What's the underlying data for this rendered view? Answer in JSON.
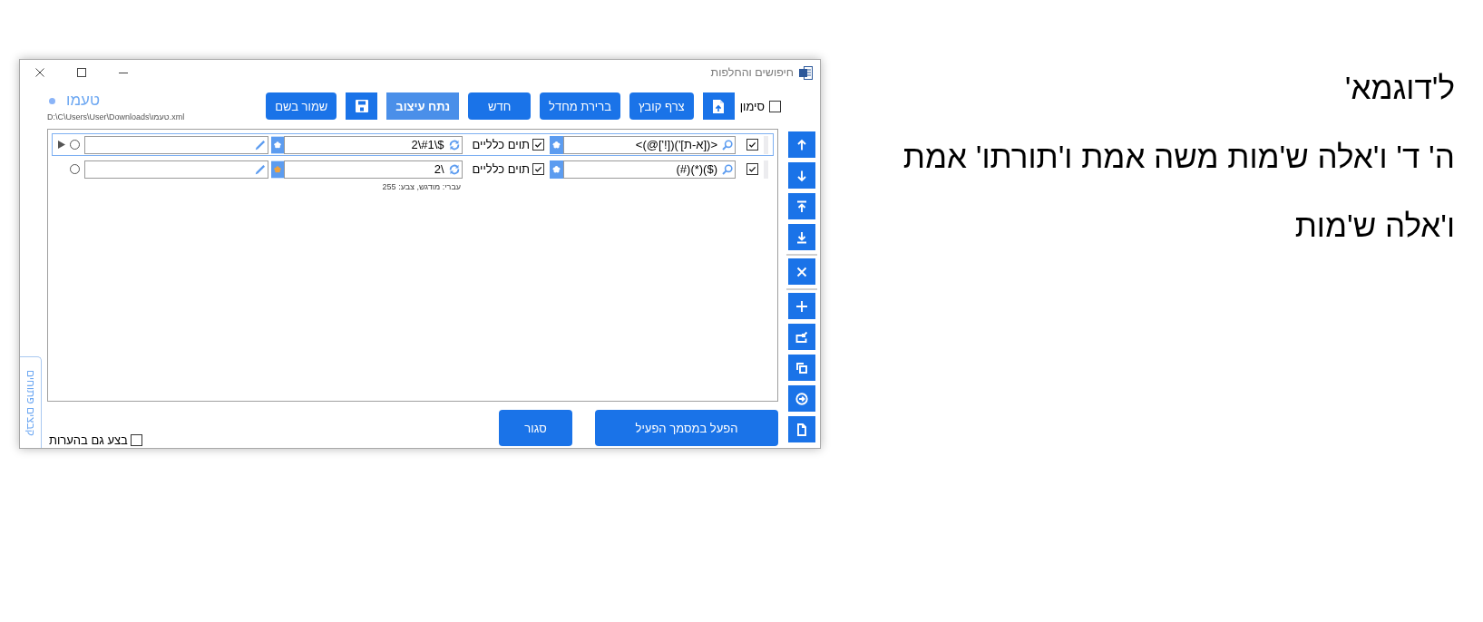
{
  "dialog": {
    "title": "חיפושים והחלפות",
    "toolbar": {
      "mark": {
        "label": "סימון",
        "checked": false
      },
      "buttons": [
        {
          "kind": "upload",
          "pressed": false
        },
        {
          "kind": "text",
          "label": "צרף קובץ",
          "pressed": false
        },
        {
          "kind": "text",
          "label": "ברירת מחדל",
          "pressed": false
        },
        {
          "kind": "text",
          "label": "חדש",
          "pressed": false
        },
        {
          "kind": "text",
          "label": "נתח עיצוב",
          "pressed": true
        },
        {
          "kind": "save",
          "pressed": false
        },
        {
          "kind": "text",
          "label": "שמור בשם",
          "pressed": false
        }
      ]
    },
    "file": {
      "indicator": true,
      "name": "טעמו",
      "path": "D:\\C\\Users\\User\\Downloads\\טעמו.xml"
    },
    "rows": [
      {
        "selected": true,
        "enabled": true,
        "find": "<([א-ת]')([!']@)>",
        "find_format": false,
        "wildcards": {
          "label": "תוים כלליים",
          "checked": true
        },
        "replace": "$\\#1\\2",
        "replace_format": false,
        "radio_checked": false
      },
      {
        "selected": false,
        "enabled": true,
        "find": "($)(*)(#)",
        "find_format": false,
        "wildcards": {
          "label": "תוים כלליים",
          "checked": true
        },
        "replace": "\\2",
        "replace_format": true,
        "format_note": "עברי: מודגש, צבע: 255",
        "radio_checked": false
      }
    ],
    "side_tab": {
      "label": "קבצים פתוחים"
    },
    "comments": {
      "label": "בצע גם בהערות",
      "checked": false
    },
    "actions": [
      {
        "label": "הפעל במסמך הפעיל"
      },
      {
        "label": "סגור"
      }
    ]
  },
  "document": {
    "lines": [
      "ל'דוגמא'",
      "ה' ד' ו'אלה ש'מות משה אמת ו'תורתו' אמת",
      "ו'אלה ש'מות"
    ]
  }
}
